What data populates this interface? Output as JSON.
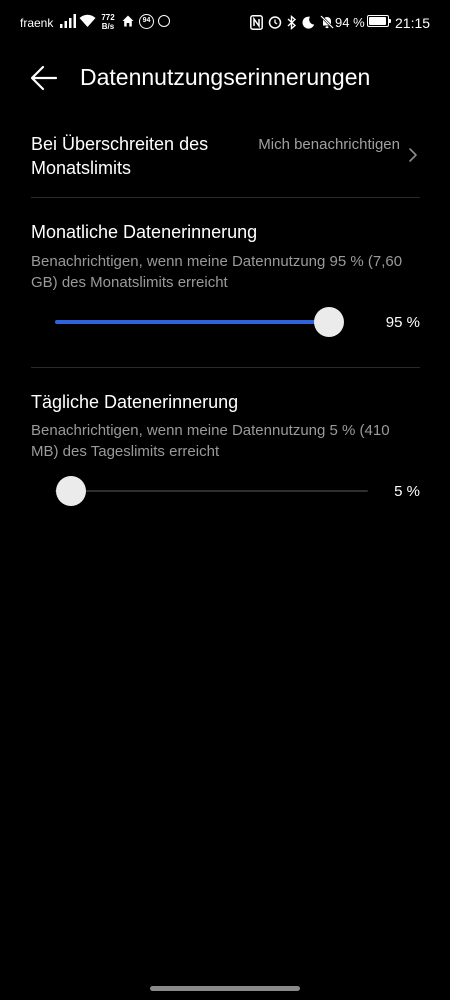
{
  "status_bar": {
    "carrier": "fraenk",
    "net_speed_value": "772",
    "net_speed_unit": "B/s",
    "aqi_badge": "94",
    "battery_percent": "94 %",
    "battery_level": 0.94,
    "time": "21:15",
    "icons": [
      "signal-icon",
      "wifi-icon",
      "home-icon",
      "nfc-icon",
      "alarm-icon",
      "bluetooth-icon",
      "moon-icon",
      "bell-off-icon",
      "battery-icon"
    ]
  },
  "header": {
    "title": "Datennutzungserinnerungen",
    "back_icon": "arrow-left-icon"
  },
  "limit_row": {
    "label": "Bei Überschreiten des Monatslimits",
    "value": "Mich benachrichtigen",
    "chevron_icon": "chevron-right-icon"
  },
  "monthly": {
    "title": "Monatliche Datenerinnerung",
    "description": "Benachrichtigen, wenn meine Datennutzung 95 % (7,60 GB) des Monatslimits erreicht",
    "slider_fraction": 0.95,
    "value_label": "95 %"
  },
  "daily": {
    "title": "Tägliche Datenerinnerung",
    "description": "Benachrichtigen, wenn meine Datennutzung 5 % (410 MB) des Tageslimits erreicht",
    "slider_fraction": 0.05,
    "value_label": "5 %"
  },
  "colors": {
    "background": "#000000",
    "accent": "#2e63d9",
    "secondary_text": "#9a9a9a"
  }
}
